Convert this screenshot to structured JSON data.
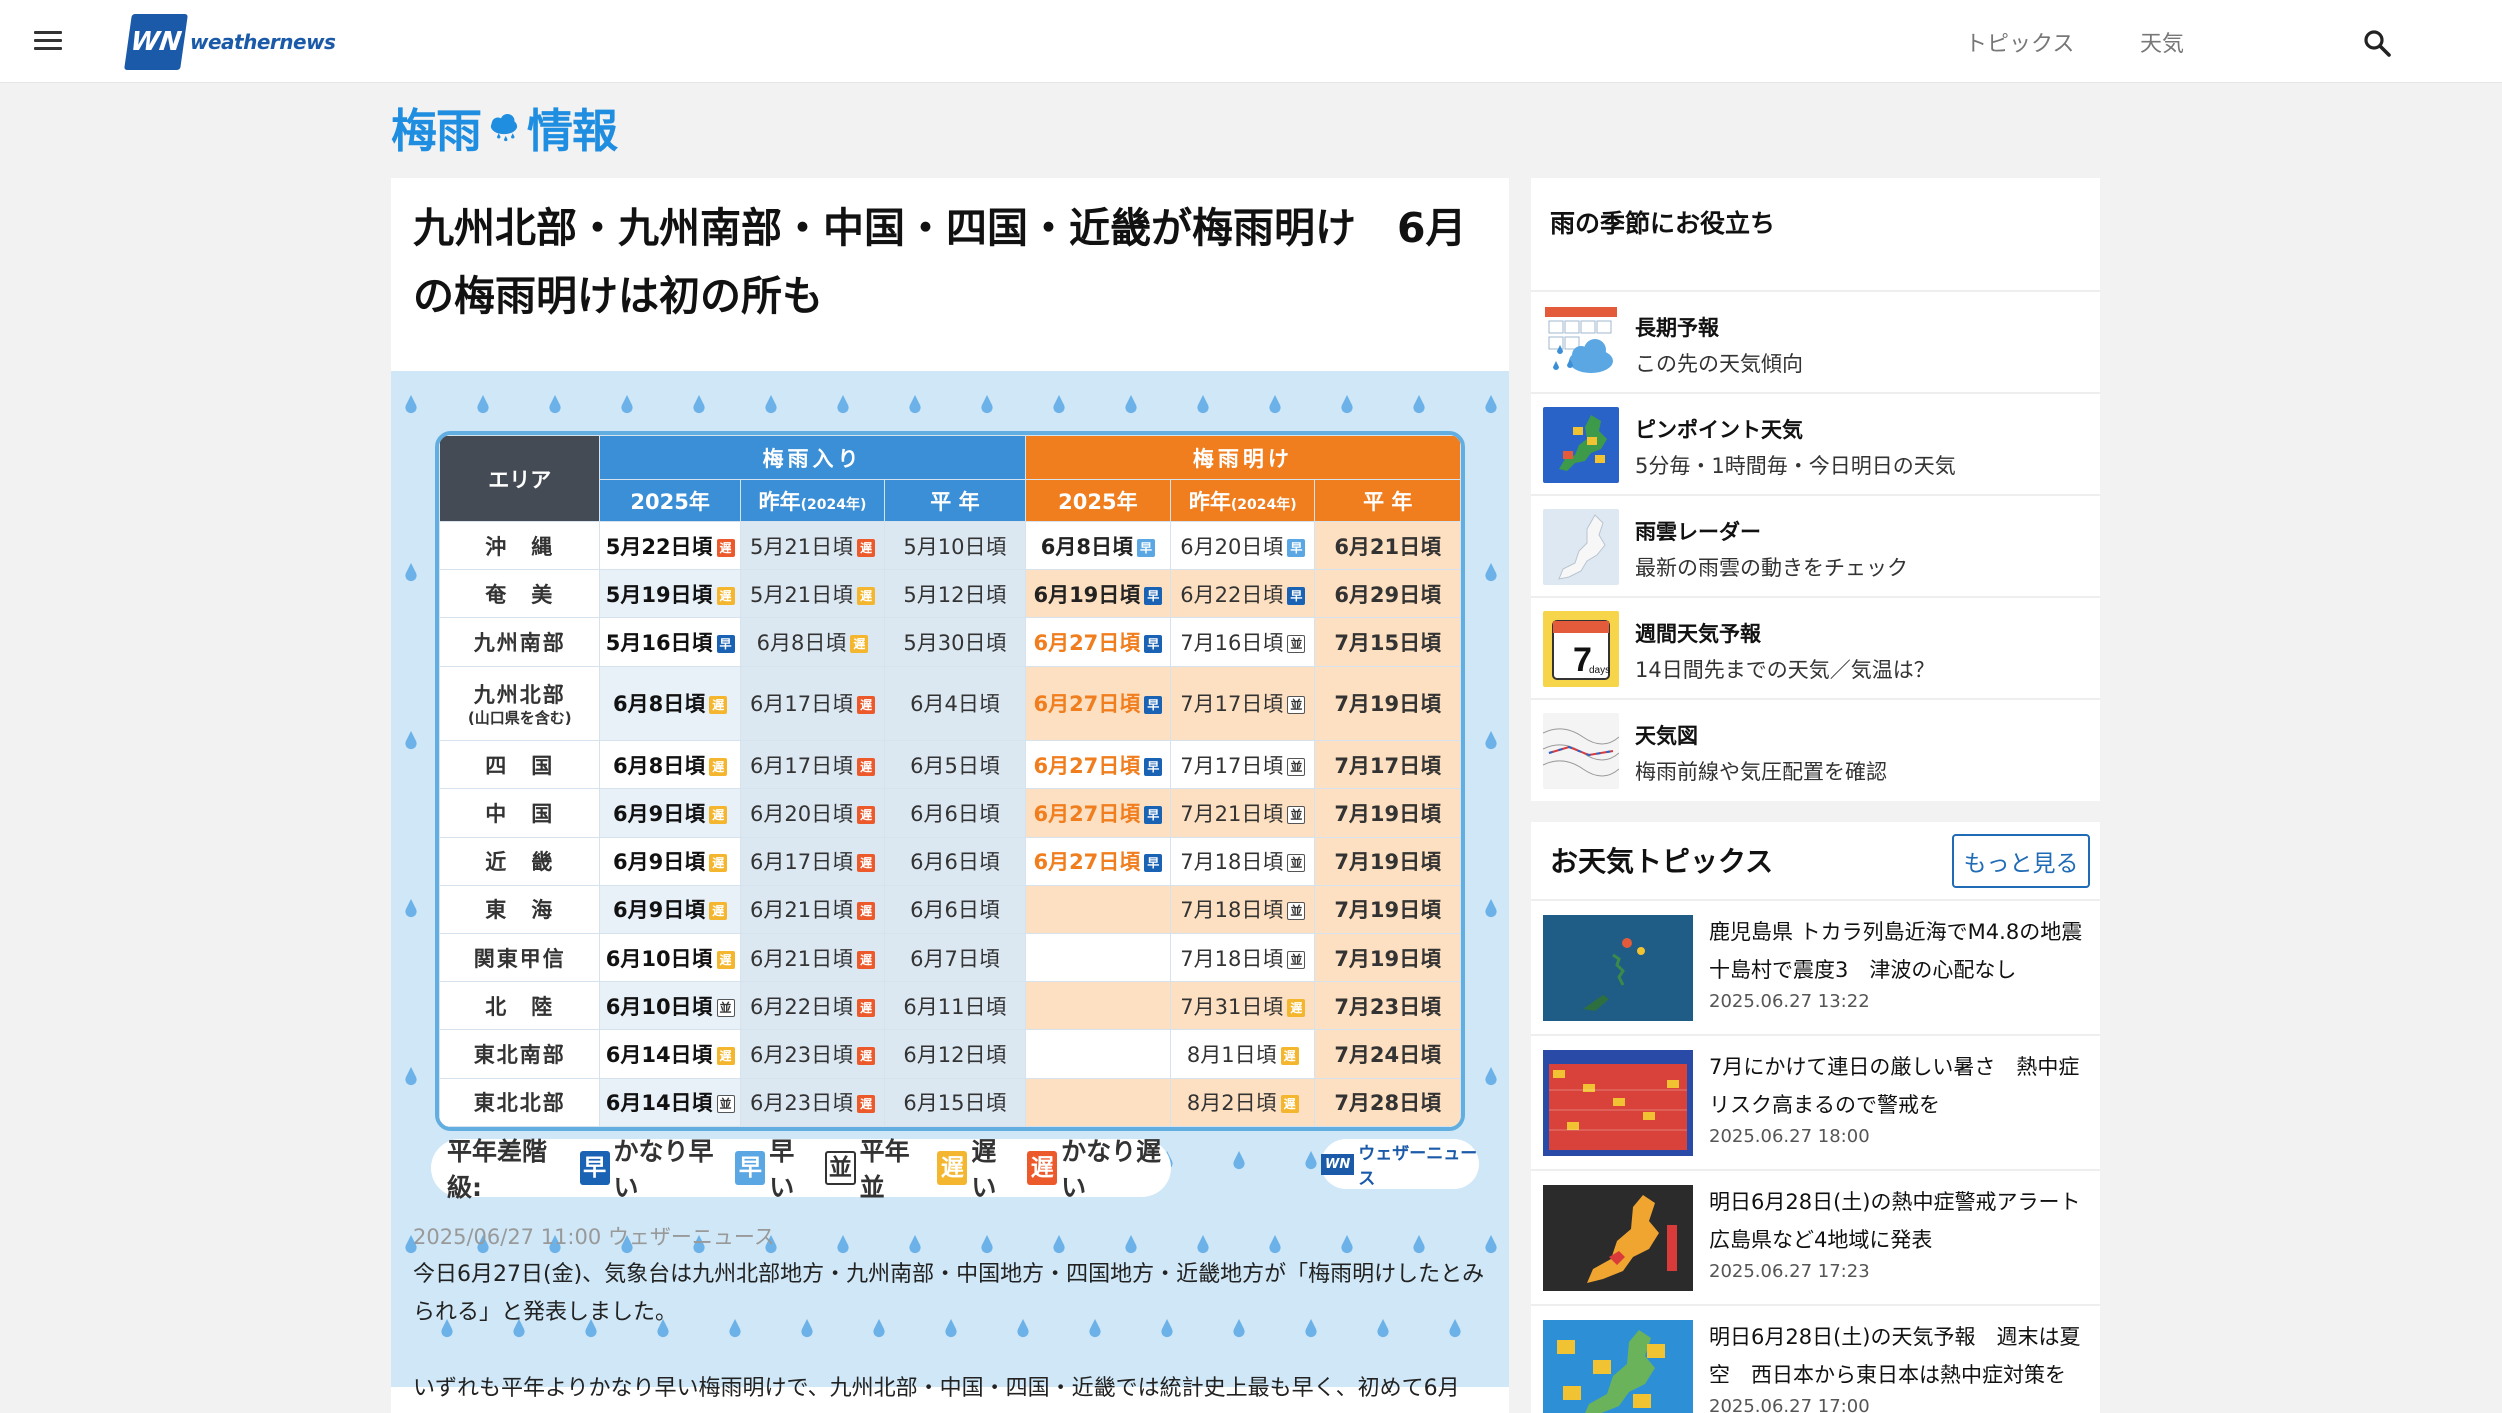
{
  "header": {
    "logo_mark": "WN",
    "logo_text": "weathernews",
    "nav": [
      "トピックス",
      "天気"
    ]
  },
  "category": {
    "title_left": "梅雨",
    "title_right": "情報"
  },
  "article": {
    "headline": "九州北部・九州南部・中国・四国・近畿が梅雨明け　6月の梅雨明けは初の所も",
    "date_line": "2025/06/27 11:00 ウェザーニュース",
    "paragraph1": "今日6月27日(金)、気象台は九州北部地方・九州南部・中国地方・四国地方・近畿地方が「梅雨明けしたとみられる」と発表しました。",
    "paragraph2": "いずれも平年よりかなり早い梅雨明けで、九州北部・中国・四国・近畿では統計史上最も早く、初めて6月"
  },
  "rainy_table": {
    "headers": {
      "area": "エリア",
      "entry": "梅雨入り",
      "exit": "梅雨明け",
      "y2025": "2025年",
      "prev": "昨年",
      "prev_note": "(2024年)",
      "normal": "平 年"
    },
    "rows": [
      {
        "area": "沖　縄",
        "sub": "",
        "in2025": "5月22日頃",
        "in2025_b": "遅",
        "in2025_c": "ko",
        "in2024": "5月21日頃",
        "in2024_b": "遅",
        "in2024_c": "ko",
        "innorm": "5月10日頃",
        "out2025": "6月8日頃",
        "out2025_b": "早",
        "out2025_c": "h",
        "out2025_orange": false,
        "out2024": "6月20日頃",
        "out2024_b": "早",
        "out2024_c": "h",
        "outnorm": "6月21日頃"
      },
      {
        "area": "奄　美",
        "sub": "",
        "in2025": "5月19日頃",
        "in2025_b": "遅",
        "in2025_c": "o",
        "in2024": "5月21日頃",
        "in2024_b": "遅",
        "in2024_c": "o",
        "innorm": "5月12日頃",
        "out2025": "6月19日頃",
        "out2025_b": "早",
        "out2025_c": "kh",
        "out2025_orange": false,
        "out2024": "6月22日頃",
        "out2024_b": "早",
        "out2024_c": "kh",
        "outnorm": "6月29日頃"
      },
      {
        "area": "九州南部",
        "sub": "",
        "in2025": "5月16日頃",
        "in2025_b": "早",
        "in2025_c": "kh",
        "in2024": "6月8日頃",
        "in2024_b": "遅",
        "in2024_c": "o",
        "innorm": "5月30日頃",
        "out2025": "6月27日頃",
        "out2025_b": "早",
        "out2025_c": "kh",
        "out2025_orange": true,
        "out2024": "7月16日頃",
        "out2024_b": "並",
        "out2024_c": "n",
        "outnorm": "7月15日頃"
      },
      {
        "area": "九州北部",
        "sub": "(山口県を含む)",
        "in2025": "6月8日頃",
        "in2025_b": "遅",
        "in2025_c": "o",
        "in2024": "6月17日頃",
        "in2024_b": "遅",
        "in2024_c": "ko",
        "innorm": "6月4日頃",
        "out2025": "6月27日頃",
        "out2025_b": "早",
        "out2025_c": "kh",
        "out2025_orange": true,
        "out2024": "7月17日頃",
        "out2024_b": "並",
        "out2024_c": "n",
        "outnorm": "7月19日頃"
      },
      {
        "area": "四　国",
        "sub": "",
        "in2025": "6月8日頃",
        "in2025_b": "遅",
        "in2025_c": "o",
        "in2024": "6月17日頃",
        "in2024_b": "遅",
        "in2024_c": "ko",
        "innorm": "6月5日頃",
        "out2025": "6月27日頃",
        "out2025_b": "早",
        "out2025_c": "kh",
        "out2025_orange": true,
        "out2024": "7月17日頃",
        "out2024_b": "並",
        "out2024_c": "n",
        "outnorm": "7月17日頃"
      },
      {
        "area": "中　国",
        "sub": "",
        "in2025": "6月9日頃",
        "in2025_b": "遅",
        "in2025_c": "o",
        "in2024": "6月20日頃",
        "in2024_b": "遅",
        "in2024_c": "ko",
        "innorm": "6月6日頃",
        "out2025": "6月27日頃",
        "out2025_b": "早",
        "out2025_c": "kh",
        "out2025_orange": true,
        "out2024": "7月21日頃",
        "out2024_b": "並",
        "out2024_c": "n",
        "outnorm": "7月19日頃"
      },
      {
        "area": "近　畿",
        "sub": "",
        "in2025": "6月9日頃",
        "in2025_b": "遅",
        "in2025_c": "o",
        "in2024": "6月17日頃",
        "in2024_b": "遅",
        "in2024_c": "ko",
        "innorm": "6月6日頃",
        "out2025": "6月27日頃",
        "out2025_b": "早",
        "out2025_c": "kh",
        "out2025_orange": true,
        "out2024": "7月18日頃",
        "out2024_b": "並",
        "out2024_c": "n",
        "outnorm": "7月19日頃"
      },
      {
        "area": "東　海",
        "sub": "",
        "in2025": "6月9日頃",
        "in2025_b": "遅",
        "in2025_c": "o",
        "in2024": "6月21日頃",
        "in2024_b": "遅",
        "in2024_c": "ko",
        "innorm": "6月6日頃",
        "out2025": "",
        "out2025_b": "",
        "out2025_c": "",
        "out2025_orange": false,
        "out2024": "7月18日頃",
        "out2024_b": "並",
        "out2024_c": "n",
        "outnorm": "7月19日頃"
      },
      {
        "area": "関東甲信",
        "sub": "",
        "in2025": "6月10日頃",
        "in2025_b": "遅",
        "in2025_c": "o",
        "in2024": "6月21日頃",
        "in2024_b": "遅",
        "in2024_c": "ko",
        "innorm": "6月7日頃",
        "out2025": "",
        "out2025_b": "",
        "out2025_c": "",
        "out2025_orange": false,
        "out2024": "7月18日頃",
        "out2024_b": "並",
        "out2024_c": "n",
        "outnorm": "7月19日頃"
      },
      {
        "area": "北　陸",
        "sub": "",
        "in2025": "6月10日頃",
        "in2025_b": "並",
        "in2025_c": "n",
        "in2024": "6月22日頃",
        "in2024_b": "遅",
        "in2024_c": "ko",
        "innorm": "6月11日頃",
        "out2025": "",
        "out2025_b": "",
        "out2025_c": "",
        "out2025_orange": false,
        "out2024": "7月31日頃",
        "out2024_b": "遅",
        "out2024_c": "o",
        "outnorm": "7月23日頃"
      },
      {
        "area": "東北南部",
        "sub": "",
        "in2025": "6月14日頃",
        "in2025_b": "遅",
        "in2025_c": "o",
        "in2024": "6月23日頃",
        "in2024_b": "遅",
        "in2024_c": "ko",
        "innorm": "6月12日頃",
        "out2025": "",
        "out2025_b": "",
        "out2025_c": "",
        "out2025_orange": false,
        "out2024": "8月1日頃",
        "out2024_b": "遅",
        "out2024_c": "o",
        "outnorm": "7月24日頃"
      },
      {
        "area": "東北北部",
        "sub": "",
        "in2025": "6月14日頃",
        "in2025_b": "並",
        "in2025_c": "n",
        "in2024": "6月23日頃",
        "in2024_b": "遅",
        "in2024_c": "ko",
        "innorm": "6月15日頃",
        "out2025": "",
        "out2025_b": "",
        "out2025_c": "",
        "out2025_orange": false,
        "out2024": "8月2日頃",
        "out2024_b": "遅",
        "out2024_c": "o",
        "outnorm": "7月28日頃"
      }
    ],
    "legend": {
      "label": "平年差階級:",
      "items": [
        {
          "badge": "早",
          "text": "かなり早い",
          "color": "#1a62b3"
        },
        {
          "badge": "早",
          "text": "早い",
          "color": "#5aa7e4"
        },
        {
          "badge": "並",
          "text": "平年並",
          "color": "#ffffff"
        },
        {
          "badge": "遅",
          "text": "遅い",
          "color": "#f4b62e"
        },
        {
          "badge": "遅",
          "text": "かなり遅い",
          "color": "#ec5a2b"
        }
      ]
    },
    "brand_badge": "ウェザーニュース",
    "brand_mark": "WN"
  },
  "sidebar": {
    "title": "雨の季節にお役立ち",
    "items": [
      {
        "title": "長期予報",
        "desc": "この先の天気傾向",
        "icon": "calendar-rain-icon"
      },
      {
        "title": "ピンポイント天気",
        "desc": "5分毎・1時間毎・今日明日の天気",
        "icon": "pinpoint-map-icon"
      },
      {
        "title": "雨雲レーダー",
        "desc": "最新の雨雲の動きをチェック",
        "icon": "radar-map-icon"
      },
      {
        "title": "週間天気予報",
        "desc": "14日間先までの天気／気温は？",
        "icon": "weekly-calendar-icon"
      },
      {
        "title": "天気図",
        "desc": "梅雨前線や気圧配置を確認",
        "icon": "weather-chart-icon"
      }
    ],
    "calendar_digit": "7",
    "calendar_unit": "days"
  },
  "topics": {
    "title": "お天気トピックス",
    "more": "もっと見る",
    "items": [
      {
        "title": "鹿児島県 トカラ列島近海でM4.8の地震　十島村で震度3　津波の心配なし",
        "date": "2025.06.27 13:22"
      },
      {
        "title": "7月にかけて連日の厳しい暑さ　熱中症リスク高まるので警戒を",
        "date": "2025.06.27 18:00"
      },
      {
        "title": "明日6月28日(土)の熱中症警戒アラート　広島県など4地域に発表",
        "date": "2025.06.27 17:23"
      },
      {
        "title": "明日6月28日(土)の天気予報　週末は夏空　西日本から東日本は熱中症対策を",
        "date": "2025.06.27 17:00"
      }
    ]
  },
  "colors": {
    "brand_blue": "#1b5aa8",
    "rain_blue": "#1f8ee0",
    "exit_orange": "#f07e1e",
    "hero_bg": "#cfe7f6"
  }
}
